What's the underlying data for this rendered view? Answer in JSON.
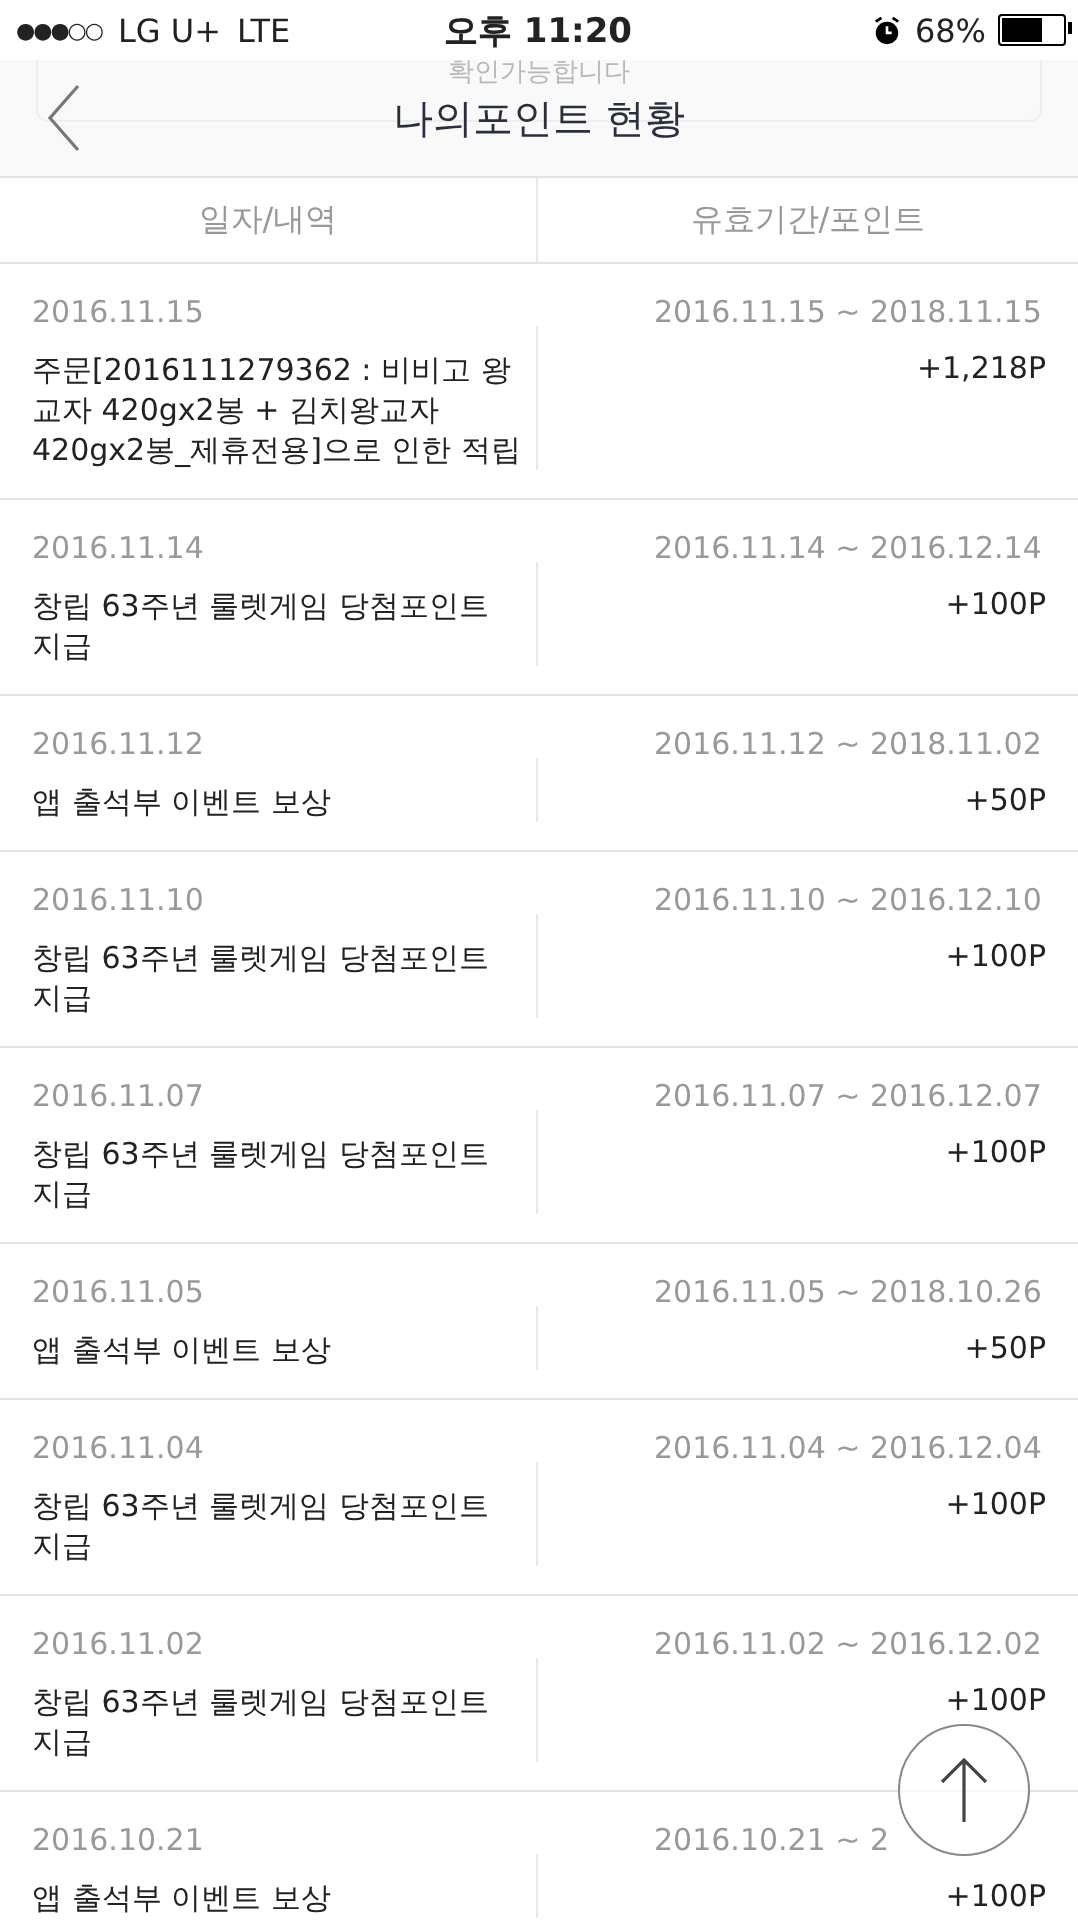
{
  "status_bar": {
    "signal": "●●●○○",
    "carrier": "LG U+",
    "network": "LTE",
    "time": "오후 11:20",
    "battery": "68%"
  },
  "header": {
    "title": "나의포인트 현황",
    "underlay_text": "확인가능합니다"
  },
  "table": {
    "columns": [
      "일자/내역",
      "유효기간/포인트"
    ],
    "rows": [
      {
        "date": "2016.11.15",
        "description": "주문[2016111279362 : 비비고 왕교자 420gx2봉 + 김치왕교자 420gx2봉_제휴전용]으로 인한 적립",
        "validity": "2016.11.15 ~ 2018.11.15",
        "points": "+1,218P"
      },
      {
        "date": "2016.11.14",
        "description": "창립 63주년 룰렛게임 당첨포인트 지급",
        "validity": "2016.11.14 ~ 2016.12.14",
        "points": "+100P"
      },
      {
        "date": "2016.11.12",
        "description": "앱 출석부 이벤트 보상",
        "validity": "2016.11.12 ~ 2018.11.02",
        "points": "+50P"
      },
      {
        "date": "2016.11.10",
        "description": "창립 63주년 룰렛게임 당첨포인트 지급",
        "validity": "2016.11.10 ~ 2016.12.10",
        "points": "+100P"
      },
      {
        "date": "2016.11.07",
        "description": "창립 63주년 룰렛게임 당첨포인트 지급",
        "validity": "2016.11.07 ~ 2016.12.07",
        "points": "+100P"
      },
      {
        "date": "2016.11.05",
        "description": "앱 출석부 이벤트 보상",
        "validity": "2016.11.05 ~ 2018.10.26",
        "points": "+50P"
      },
      {
        "date": "2016.11.04",
        "description": "창립 63주년 룰렛게임 당첨포인트 지급",
        "validity": "2016.11.04 ~ 2016.12.04",
        "points": "+100P"
      },
      {
        "date": "2016.11.02",
        "description": "창립 63주년 룰렛게임 당첨포인트 지급",
        "validity": "2016.11.02 ~ 2016.12.02",
        "points": "+100P"
      },
      {
        "date": "2016.10.21",
        "description": "앱 출석부 이벤트 보상",
        "validity": "2016.10.21 ~ 2",
        "points": "+100P"
      }
    ]
  }
}
